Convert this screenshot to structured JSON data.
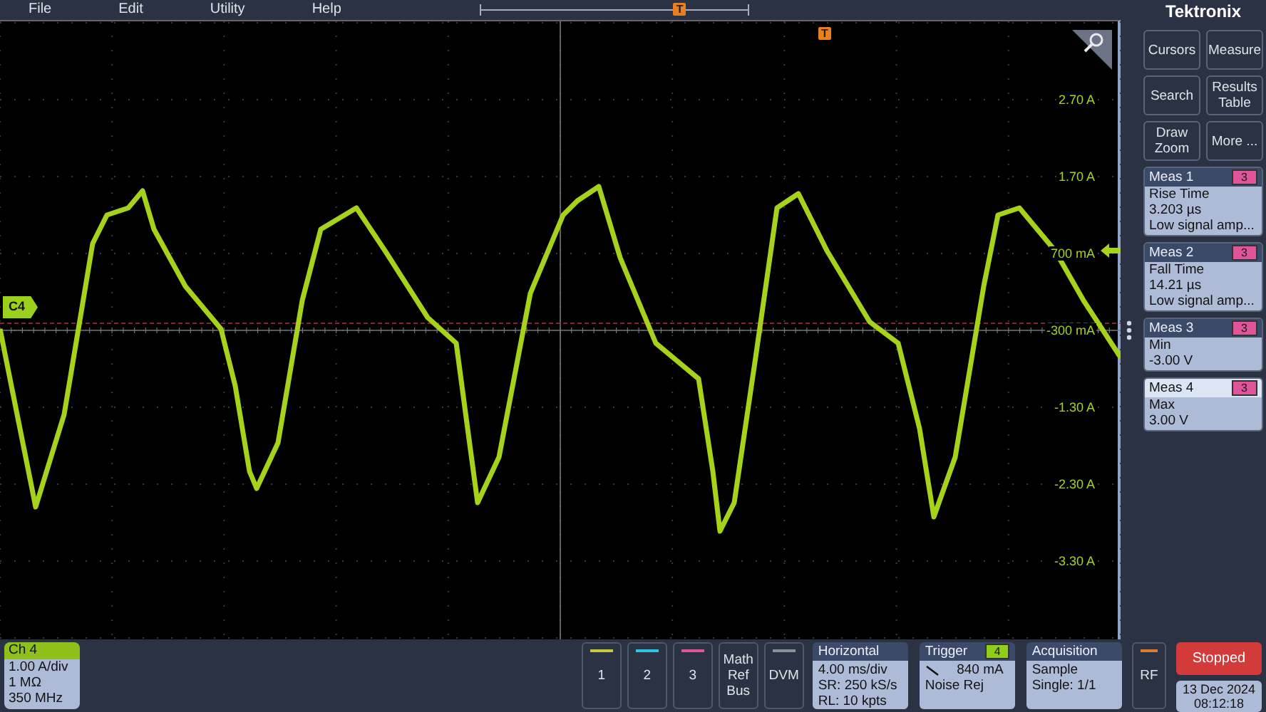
{
  "menu": [
    {
      "label": "File"
    },
    {
      "label": "Edit"
    },
    {
      "label": "Utility"
    },
    {
      "label": "Help"
    }
  ],
  "timeline": {
    "marker": "T"
  },
  "plot": {
    "trigger_marker": "T",
    "channel_tag": "C4",
    "y_labels": [
      "2.70 A",
      "1.70 A",
      "700 mA",
      "-300 mA",
      "-1.30 A",
      "-2.30 A",
      "-3.30 A"
    ]
  },
  "sidebar": {
    "logo": "Tektronix",
    "buttons": [
      {
        "lines": [
          "Cursors"
        ]
      },
      {
        "lines": [
          "Search"
        ]
      },
      {
        "lines": [
          "Draw",
          "Zoom"
        ]
      },
      {
        "lines": [
          "Measure"
        ]
      },
      {
        "lines": [
          "Results",
          "Table"
        ]
      },
      {
        "lines": [
          "More ..."
        ]
      }
    ],
    "measurements": [
      {
        "title": "Meas 1",
        "badge": "3",
        "lines": [
          "Rise Time",
          "3.203 µs",
          "Low signal amp..."
        ],
        "selected": false
      },
      {
        "title": "Meas 2",
        "badge": "3",
        "lines": [
          "Fall Time",
          "14.21 µs",
          "Low signal amp..."
        ],
        "selected": false
      },
      {
        "title": "Meas 3",
        "badge": "3",
        "lines": [
          "Min",
          "-3.00 V"
        ],
        "selected": false
      },
      {
        "title": "Meas 4",
        "badge": "3",
        "lines": [
          "Max",
          "3.00 V"
        ],
        "selected": true
      }
    ]
  },
  "bottom": {
    "channel": {
      "title": "Ch 4",
      "lines": [
        "1.00 A/div",
        "1 MΩ",
        "350 MHz"
      ]
    },
    "channel_buttons": [
      {
        "lines": [
          "1"
        ],
        "color": "#c8c83c"
      },
      {
        "lines": [
          "2"
        ],
        "color": "#2ec4e4"
      },
      {
        "lines": [
          "3"
        ],
        "color": "#e0559a"
      },
      {
        "lines": [
          "Math",
          "Ref",
          "Bus"
        ]
      },
      {
        "lines": [
          "DVM"
        ],
        "color": "#8a8f99"
      }
    ],
    "panels": [
      {
        "kind": "plain",
        "title": "Horizontal",
        "lines": [
          "4.00 ms/div",
          "SR: 250 kS/s",
          "RL: 10 kpts"
        ]
      },
      {
        "kind": "trigger",
        "title": "Trigger",
        "badge": "4",
        "lines": [
          "840 mA",
          "Noise Rej"
        ]
      },
      {
        "kind": "plain",
        "title": "Acquisition",
        "lines": [
          "Sample",
          "Single: 1/1"
        ]
      }
    ],
    "rf_button": {
      "label": "RF",
      "color": "#e07a30"
    },
    "run_state": {
      "label": "Stopped"
    },
    "date": "13 Dec 2024",
    "time": "08:12:18"
  }
}
